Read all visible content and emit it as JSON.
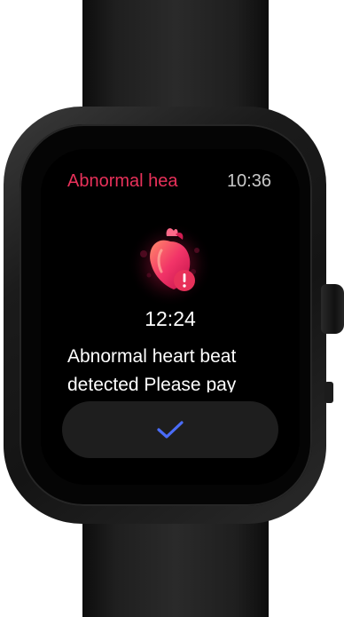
{
  "watch": {
    "status_bar": {
      "title": "Abnormal hea",
      "time": "10:36"
    },
    "alert": {
      "icon": "heart-warning-icon",
      "time": "12:24",
      "message_lines": [
        "Abnormal heart beat",
        "detected Please pay"
      ]
    },
    "confirm_button": {
      "icon": "check-icon"
    },
    "colors": {
      "accent": "#e8315a",
      "check": "#4a6cf7",
      "screen": "#000000"
    }
  }
}
